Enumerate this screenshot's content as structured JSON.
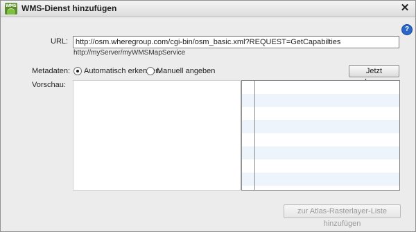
{
  "window": {
    "title": "WMS-Dienst hinzufügen",
    "icon_text": "WMS",
    "close_symbol": "✕",
    "help_symbol": "?"
  },
  "form": {
    "url_label": "URL:",
    "url_value": "http://osm.wheregroup.com/cgi-bin/osm_basic.xml?REQUEST=GetCapabilties",
    "url_hint": "http://myServer/myWMSMapService",
    "metadata_label": "Metadaten:",
    "metadata_options": [
      {
        "label": "Automatisch erkennen",
        "selected": true
      },
      {
        "label": "Manuell angeben",
        "selected": false
      }
    ],
    "detect_button": "Jetzt erkennen",
    "preview_label": "Vorschau:"
  },
  "footer": {
    "add_button": "zur Atlas-Rasterlayer-Liste hinzufügen",
    "add_button_enabled": false
  },
  "icons": [
    "wms-app-icon",
    "close-icon",
    "help-icon"
  ]
}
